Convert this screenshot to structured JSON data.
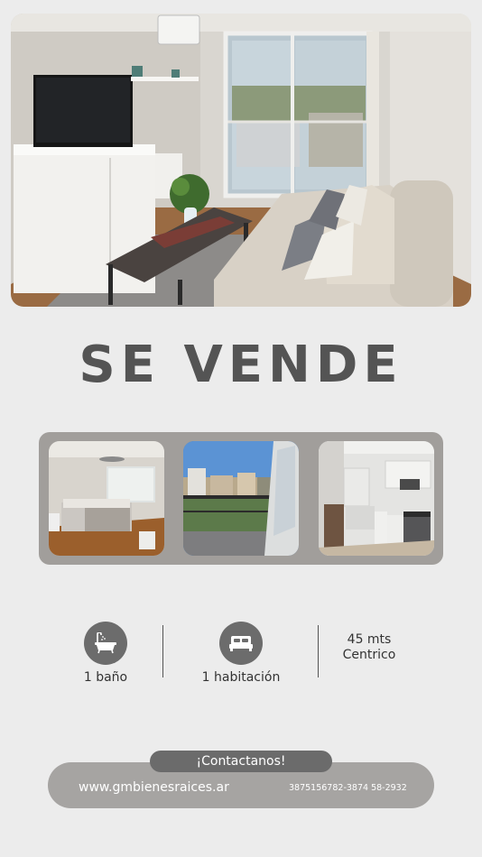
{
  "headline": "SE VENDE",
  "features": [
    {
      "label": "1 baño",
      "icon": "bathtub-icon"
    },
    {
      "label": "1 habitación",
      "icon": "bed-icon"
    },
    {
      "label": "45 mts",
      "icon": ""
    },
    {
      "label": "Centrico",
      "icon": ""
    }
  ],
  "contact": {
    "label": "¡Contactanos!",
    "website": "www.gmbienesraices.ar",
    "phones": "3875156782-3874 58-2932"
  },
  "photos": {
    "hero": "living-room-photo",
    "thumbs": [
      "bedroom-photo",
      "balcony-view-photo",
      "kitchen-photo"
    ]
  },
  "colors": {
    "background": "#ececec",
    "headline": "#545454",
    "icon_circle": "#6c6c6c",
    "gallery_frame": "#a19e9b",
    "contact_pill": "#a6a4a2",
    "contact_tag": "#6b6b6b"
  }
}
